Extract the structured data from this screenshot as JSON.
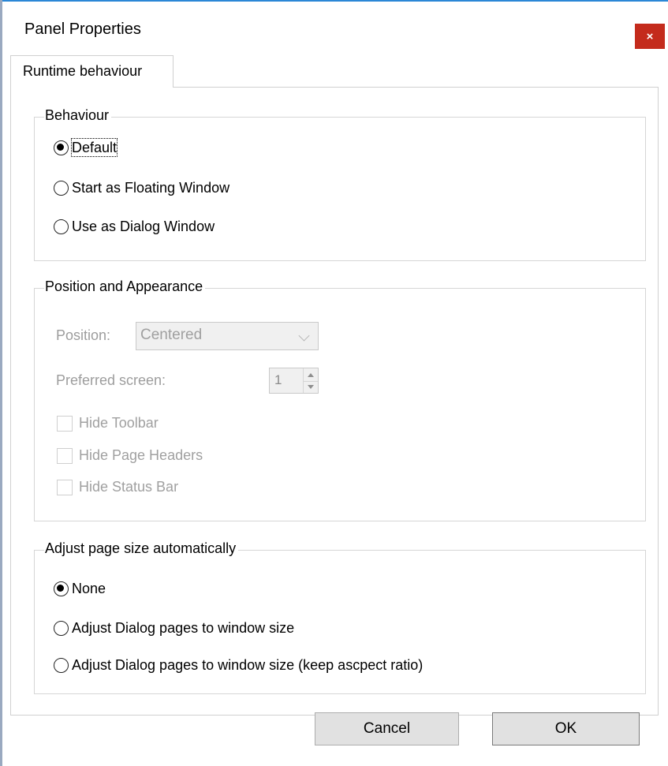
{
  "window": {
    "title": "Panel Properties",
    "close_glyph": "×"
  },
  "tabs": [
    {
      "label": "Runtime behaviour",
      "active": true
    }
  ],
  "behaviour": {
    "legend": "Behaviour",
    "options": [
      {
        "label": "Default",
        "checked": true
      },
      {
        "label": "Start as Floating Window",
        "checked": false
      },
      {
        "label": "Use as Dialog Window",
        "checked": false
      }
    ]
  },
  "position_appearance": {
    "legend": "Position and Appearance",
    "position_label": "Position:",
    "position_value": "Centered",
    "preferred_screen_label": "Preferred screen:",
    "preferred_screen_value": "1",
    "checkboxes": [
      {
        "label": "Hide Toolbar",
        "checked": false
      },
      {
        "label": "Hide Page Headers",
        "checked": false
      },
      {
        "label": "Hide Status Bar",
        "checked": false
      }
    ]
  },
  "adjust_page_size": {
    "legend": "Adjust page size automatically",
    "options": [
      {
        "label": "None",
        "checked": true
      },
      {
        "label": "Adjust Dialog pages to window size",
        "checked": false
      },
      {
        "label": "Adjust Dialog pages to window size (keep ascpect ratio)",
        "checked": false
      }
    ]
  },
  "buttons": {
    "cancel": "Cancel",
    "ok": "OK"
  },
  "colors": {
    "close_button": "#c42b1c",
    "window_accent": "#2b87d6",
    "disabled_text": "#9d9d9d"
  }
}
